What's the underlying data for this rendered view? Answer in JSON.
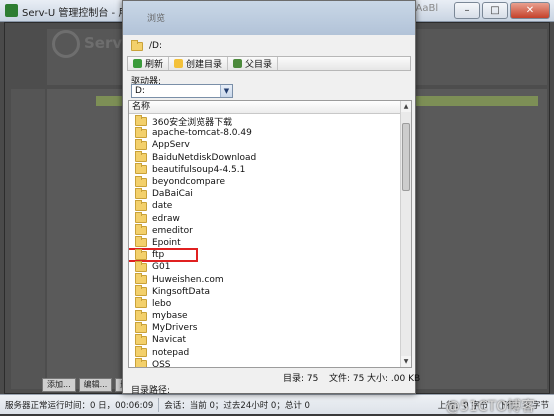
{
  "main_window": {
    "title": "Serv-U 管理控制台 - 用户",
    "ghost_title": "AaBbAaBb AaBl",
    "ghost_logo": "Serv",
    "win_min": "–",
    "win_max": "□",
    "win_close": "✕",
    "bottom_buttons": [
      "添加...",
      "编辑...",
      "删除"
    ]
  },
  "status_bar": {
    "uptime": "服务器正常运行时间：0 日，00:06:09",
    "sessions": "会话：当前 0；过去24小时 0；总计 0",
    "upload": "上行：0 字节",
    "download": "下行：0 字节"
  },
  "watermark": "@51CTO博客",
  "dialog": {
    "title": "浏览",
    "current_path": "/D:",
    "toolbar": {
      "refresh": "刷新",
      "create_dir": "创建目录",
      "parent_dir": "父目录"
    },
    "drive_label": "驱动器:",
    "drive_value": "D:",
    "column_header": "名称",
    "folders": [
      "360安全浏览器下载",
      "apache-tomcat-8.0.49",
      "AppServ",
      "BaiduNetdiskDownload",
      "beautifulsoup4-4.5.1",
      "beyondcompare",
      "DaBaiCai",
      "date",
      "edraw",
      "emeditor",
      "Epoint",
      "ftp",
      "G01",
      "Huweishen.com",
      "KingsoftData",
      "lebo",
      "mybase",
      "MyDrivers",
      "Navicat",
      "notepad",
      "OSS"
    ],
    "highlighted_folder": "ftp",
    "counts": {
      "dirs": "目录: 75",
      "files": "文件: 75",
      "size": "大小: .00 KB"
    },
    "target_path_label": "目录路径:"
  },
  "colors": {
    "highlight_border": "#e02020",
    "folder": "#f3d06b"
  }
}
